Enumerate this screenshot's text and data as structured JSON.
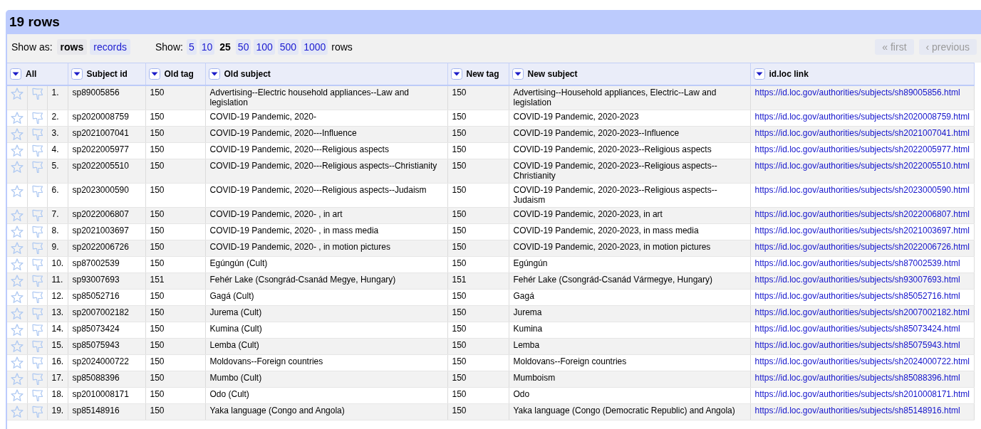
{
  "title": "19 rows",
  "toolbar": {
    "show_as_label": "Show as:",
    "show_as_options": [
      {
        "label": "rows",
        "selected": true
      },
      {
        "label": "records",
        "selected": false
      }
    ],
    "show_label": "Show:",
    "page_sizes": [
      {
        "label": "5",
        "selected": false
      },
      {
        "label": "10",
        "selected": false
      },
      {
        "label": "25",
        "selected": true
      },
      {
        "label": "50",
        "selected": false
      },
      {
        "label": "100",
        "selected": false
      },
      {
        "label": "500",
        "selected": false
      },
      {
        "label": "1000",
        "selected": false
      }
    ],
    "page_sizes_suffix": "rows",
    "pagination": [
      {
        "label": "« first",
        "disabled": true
      },
      {
        "label": "‹ previous",
        "disabled": true
      }
    ]
  },
  "table": {
    "columns": [
      {
        "label": "All",
        "kind": "all"
      },
      {
        "label": "Subject id",
        "kind": "text"
      },
      {
        "label": "Old tag",
        "kind": "text"
      },
      {
        "label": "Old subject",
        "kind": "text"
      },
      {
        "label": "New tag",
        "kind": "text"
      },
      {
        "label": "New subject",
        "kind": "text"
      },
      {
        "label": "id.loc link",
        "kind": "link"
      }
    ],
    "rows": [
      {
        "starred": false,
        "flagged": false,
        "cells": [
          "1.",
          "sp89005856",
          "150",
          "Advertising--Electric household appliances--Law and legislation",
          "150",
          "Advertising--Household appliances, Electric--Law and legislation",
          "https://id.loc.gov/authorities/subjects/sh89005856.html"
        ]
      },
      {
        "starred": false,
        "flagged": false,
        "cells": [
          "2.",
          "sp2020008759",
          "150",
          "COVID-19 Pandemic, 2020-",
          "150",
          "COVID-19 Pandemic, 2020-2023",
          "https://id.loc.gov/authorities/subjects/sh2020008759.html"
        ]
      },
      {
        "starred": false,
        "flagged": false,
        "cells": [
          "3.",
          "sp2021007041",
          "150",
          "COVID-19 Pandemic, 2020---Influence",
          "150",
          "COVID-19 Pandemic, 2020-2023--Influence",
          "https://id.loc.gov/authorities/subjects/sh2021007041.html"
        ]
      },
      {
        "starred": false,
        "flagged": false,
        "cells": [
          "4.",
          "sp2022005977",
          "150",
          "COVID-19 Pandemic, 2020---Religious aspects",
          "150",
          "COVID-19 Pandemic, 2020-2023--Religious aspects",
          "https://id.loc.gov/authorities/subjects/sh2022005977.html"
        ]
      },
      {
        "starred": false,
        "flagged": false,
        "cells": [
          "5.",
          "sp2022005510",
          "150",
          "COVID-19 Pandemic, 2020---Religious aspects--Christianity",
          "150",
          "COVID-19 Pandemic, 2020-2023--Religious aspects--Christianity",
          "https://id.loc.gov/authorities/subjects/sh2022005510.html"
        ]
      },
      {
        "starred": false,
        "flagged": false,
        "cells": [
          "6.",
          "sp2023000590",
          "150",
          "COVID-19 Pandemic, 2020---Religious aspects--Judaism",
          "150",
          "COVID-19 Pandemic, 2020-2023--Religious aspects--Judaism",
          "https://id.loc.gov/authorities/subjects/sh2023000590.html"
        ]
      },
      {
        "starred": false,
        "flagged": false,
        "cells": [
          "7.",
          "sp2022006807",
          "150",
          "COVID-19 Pandemic, 2020- , in art",
          "150",
          "COVID-19 Pandemic, 2020-2023, in art",
          "https://id.loc.gov/authorities/subjects/sh2022006807.html"
        ]
      },
      {
        "starred": false,
        "flagged": false,
        "cells": [
          "8.",
          "sp2021003697",
          "150",
          "COVID-19 Pandemic, 2020- , in mass media",
          "150",
          "COVID-19 Pandemic, 2020-2023, in mass media",
          "https://id.loc.gov/authorities/subjects/sh2021003697.html"
        ]
      },
      {
        "starred": false,
        "flagged": false,
        "cells": [
          "9.",
          "sp2022006726",
          "150",
          "COVID-19 Pandemic, 2020- , in motion pictures",
          "150",
          "COVID-19 Pandemic, 2020-2023, in motion pictures",
          "https://id.loc.gov/authorities/subjects/sh2022006726.html"
        ]
      },
      {
        "starred": false,
        "flagged": false,
        "cells": [
          "10.",
          "sp87002539",
          "150",
          "Egúngún (Cult)",
          "150",
          "Egúngún",
          "https://id.loc.gov/authorities/subjects/sh87002539.html"
        ]
      },
      {
        "starred": false,
        "flagged": false,
        "cells": [
          "11.",
          "sp93007693",
          "151",
          "Fehér Lake (Csongrád-Csanád Megye, Hungary)",
          "151",
          "Fehér Lake (Csongrád-Csanád Vármegye, Hungary)",
          "https://id.loc.gov/authorities/subjects/sh93007693.html"
        ]
      },
      {
        "starred": false,
        "flagged": false,
        "cells": [
          "12.",
          "sp85052716",
          "150",
          "Gagá (Cult)",
          "150",
          "Gagá",
          "https://id.loc.gov/authorities/subjects/sh85052716.html"
        ]
      },
      {
        "starred": false,
        "flagged": false,
        "cells": [
          "13.",
          "sp2007002182",
          "150",
          "Jurema (Cult)",
          "150",
          "Jurema",
          "https://id.loc.gov/authorities/subjects/sh2007002182.html"
        ]
      },
      {
        "starred": false,
        "flagged": false,
        "cells": [
          "14.",
          "sp85073424",
          "150",
          "Kumina (Cult)",
          "150",
          "Kumina",
          "https://id.loc.gov/authorities/subjects/sh85073424.html"
        ]
      },
      {
        "starred": false,
        "flagged": false,
        "cells": [
          "15.",
          "sp85075943",
          "150",
          "Lemba (Cult)",
          "150",
          "Lemba",
          "https://id.loc.gov/authorities/subjects/sh85075943.html"
        ]
      },
      {
        "starred": false,
        "flagged": false,
        "cells": [
          "16.",
          "sp2024000722",
          "150",
          "Moldovans--Foreign countries",
          "150",
          "Moldovans--Foreign countries",
          "https://id.loc.gov/authorities/subjects/sh2024000722.html"
        ]
      },
      {
        "starred": false,
        "flagged": false,
        "cells": [
          "17.",
          "sp85088396",
          "150",
          "Mumbo (Cult)",
          "150",
          "Mumboism",
          "https://id.loc.gov/authorities/subjects/sh85088396.html"
        ]
      },
      {
        "starred": false,
        "flagged": false,
        "cells": [
          "18.",
          "sp2010008171",
          "150",
          "Odo (Cult)",
          "150",
          "Odo",
          "https://id.loc.gov/authorities/subjects/sh2010008171.html"
        ]
      },
      {
        "starred": false,
        "flagged": false,
        "cells": [
          "19.",
          "sp85148916",
          "150",
          "Yaka language (Congo and Angola)",
          "150",
          "Yaka language (Congo (Democratic Republic) and Angola)",
          "https://id.loc.gov/authorities/subjects/sh85148916.html"
        ]
      }
    ]
  }
}
